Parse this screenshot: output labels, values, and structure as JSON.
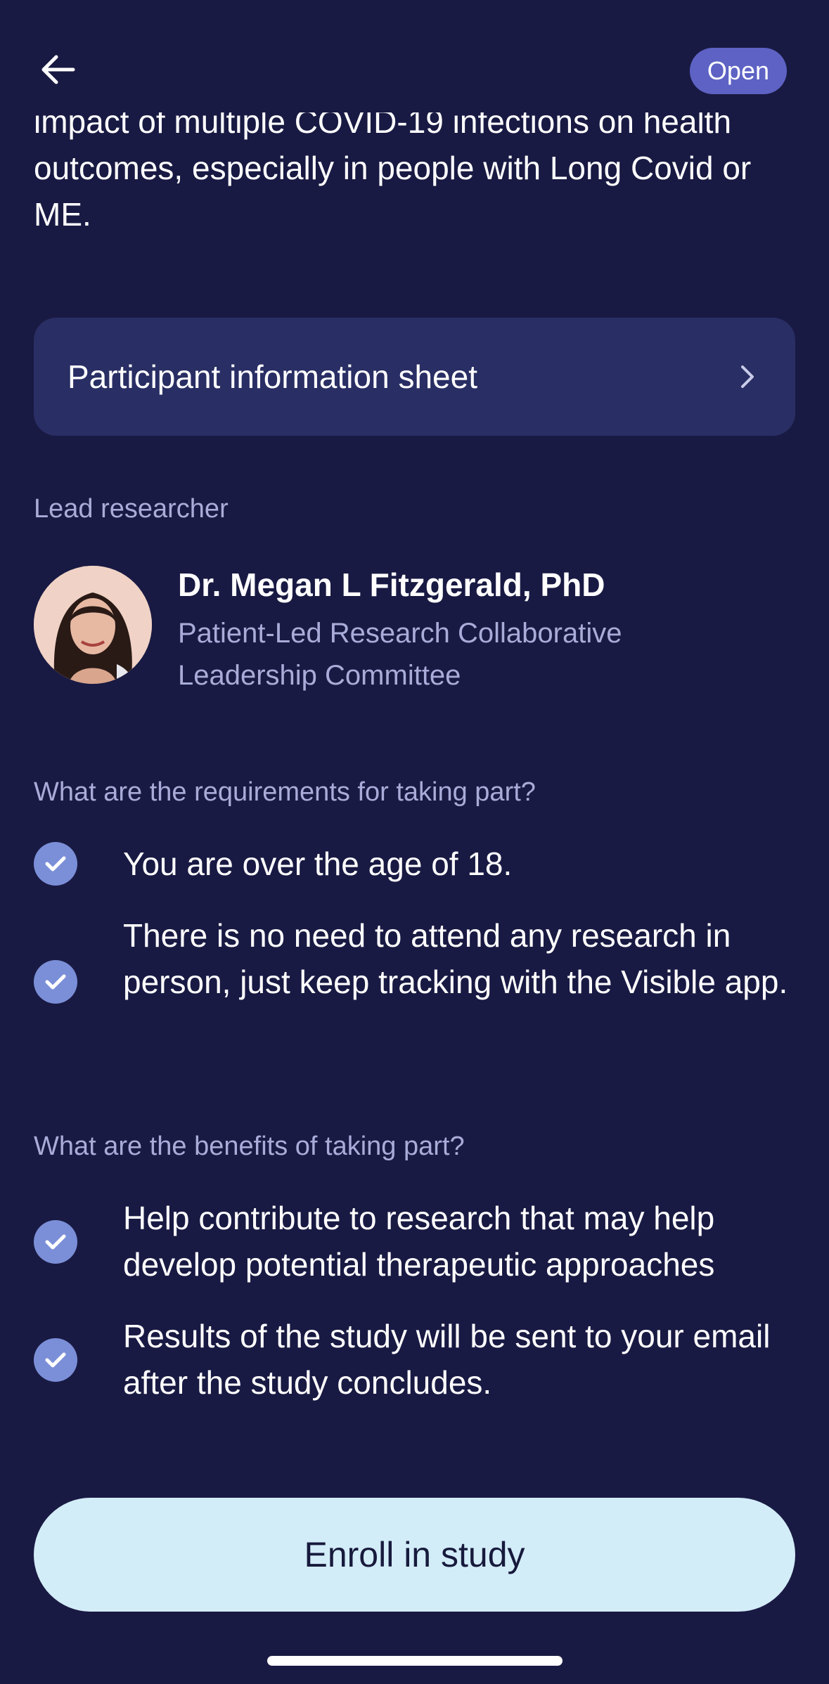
{
  "header": {
    "status_badge": "Open"
  },
  "intro": {
    "clipped_line": "impact of multiple COVID-19 infections on health",
    "visible_text": "outcomes, especially in people with Long Covid or ME."
  },
  "info_sheet": {
    "label": "Participant information sheet"
  },
  "lead_researcher": {
    "section_label": "Lead researcher",
    "name": "Dr. Megan L Fitzgerald, PhD",
    "organization": "Patient-Led Research Collaborative Leadership Committee"
  },
  "requirements": {
    "section_label": "What are the requirements for taking part?",
    "items": [
      "You are over the age of 18.",
      "There is no need to attend any research in person, just keep tracking with the Visible app."
    ]
  },
  "benefits": {
    "section_label": "What are the benefits of taking part?",
    "items": [
      "Help contribute to research that may help develop potential therapeutic approaches",
      "Results of the study will be sent to your email after the study concludes."
    ]
  },
  "enroll": {
    "label": "Enroll in study"
  },
  "colors": {
    "background": "#191a43",
    "card": "#292e64",
    "badge": "#5d62c4",
    "check": "#7b8fd8",
    "muted_text": "#a9acd8",
    "enroll_button": "#d3edf8"
  }
}
